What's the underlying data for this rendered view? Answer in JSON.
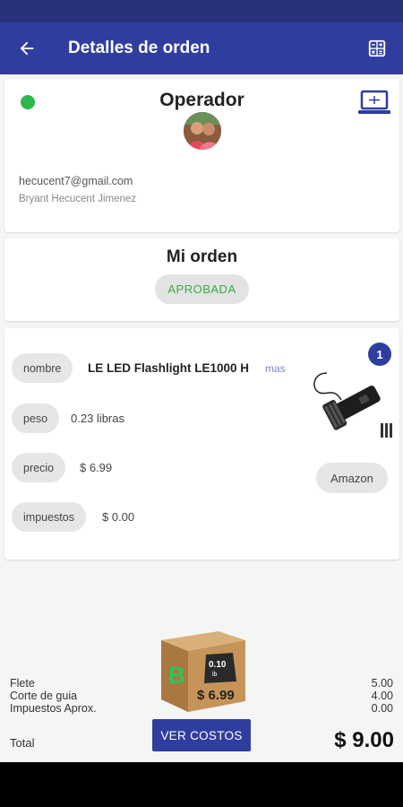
{
  "header": {
    "title": "Detalles de orden",
    "back_icon": "arrow-left-icon",
    "calc_icon": "calculator-icon"
  },
  "operator": {
    "title": "Operador",
    "status_color": "#2db84d",
    "email": "hecucent7@gmail.com",
    "name": "Bryant Hecucent Jimenez"
  },
  "order": {
    "title": "Mi orden",
    "status": "APROBADA"
  },
  "product": {
    "name_label": "nombre",
    "name": "LE LED Flashlight LE1000 H",
    "more_label": "mas",
    "weight_label": "peso",
    "weight": "0.23 libras",
    "price_label": "precio",
    "price": "$ 6.99",
    "tax_label": "impuestos",
    "tax": "$ 0.00",
    "quantity": "1",
    "store": "Amazon"
  },
  "box": {
    "weight_text": "0.10",
    "unit_text": "lb",
    "price_text": "$ 6.99",
    "letter": "B"
  },
  "summary": {
    "rows": [
      {
        "label": "Flete",
        "value": "5.00"
      },
      {
        "label": "Corte de guia",
        "value": "4.00"
      },
      {
        "label": "Impuestos Aprox.",
        "value": "0.00"
      }
    ],
    "total_label": "Total",
    "total_value": "$ 9.00",
    "button_label": "VER COSTOS"
  },
  "colors": {
    "primary": "#2f3e9e",
    "status_bar": "#27327a",
    "approved": "#3aaa4a"
  }
}
